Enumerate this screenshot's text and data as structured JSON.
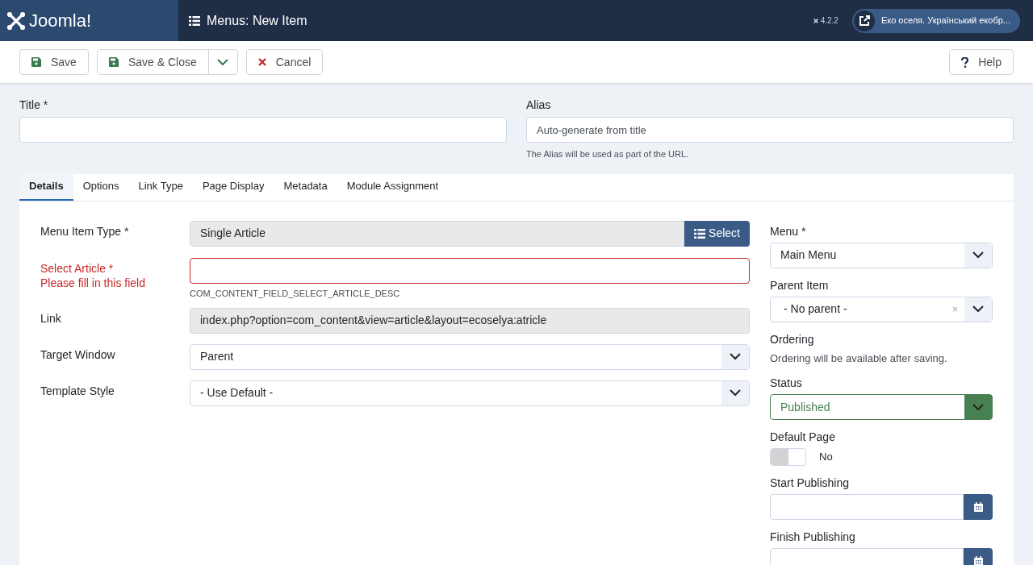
{
  "header": {
    "logo_text": "Joomla!",
    "page_title": "Menus: New Item",
    "version": "4.2.2",
    "site_link": "Еко оселя. Український екобр..."
  },
  "toolbar": {
    "buttons": [
      {
        "label": "Save",
        "kind": "save",
        "dropdown": false
      },
      {
        "label": "Save & Close",
        "kind": "save",
        "dropdown": true
      },
      {
        "label": "Cancel",
        "kind": "cancel",
        "dropdown": false
      }
    ],
    "help": {
      "label": "Help"
    }
  },
  "title_field": {
    "label": "Title *"
  },
  "alias_field": {
    "label": "Alias",
    "placeholder": "Auto-generate from title",
    "hint": "The Alias will be used as part of the URL."
  },
  "tabs": [
    {
      "label": "Details",
      "selected": true
    },
    {
      "label": "Options",
      "selected": false
    },
    {
      "label": "Link Type",
      "selected": false
    },
    {
      "label": "Page Display",
      "selected": false
    },
    {
      "label": "Metadata",
      "selected": false
    },
    {
      "label": "Module Assignment",
      "selected": false
    }
  ],
  "main_fields": [
    {
      "kind": "picker",
      "label": "Menu Item Type *",
      "value": "Single Article",
      "button": "Select"
    },
    {
      "kind": "invalid",
      "label": "Select Article *",
      "error": "Please fill in this field",
      "hint": "COM_CONTENT_FIELD_SELECT_ARTICLE_DESC"
    },
    {
      "kind": "readonly",
      "label": "Link",
      "value": "index.php?option=com_content&view=article&layout=ecoselya:atricle"
    },
    {
      "kind": "select",
      "label": "Target Window",
      "value": "Parent"
    },
    {
      "kind": "select",
      "label": "Template Style",
      "value": "- Use Default -"
    }
  ],
  "side_fields": [
    {
      "kind": "select",
      "label": "Menu *",
      "value": "Main Menu"
    },
    {
      "kind": "clearable",
      "label": "Parent Item",
      "value": "- No parent -",
      "clear": "×"
    },
    {
      "kind": "note",
      "label": "Ordering",
      "value": "Ordering will be available after saving."
    },
    {
      "kind": "status",
      "label": "Status",
      "value": "Published"
    },
    {
      "kind": "toggle",
      "label": "Default Page",
      "on": false,
      "value": "No"
    },
    {
      "kind": "date",
      "label": "Start Publishing"
    },
    {
      "kind": "date",
      "label": "Finish Publishing"
    }
  ]
}
